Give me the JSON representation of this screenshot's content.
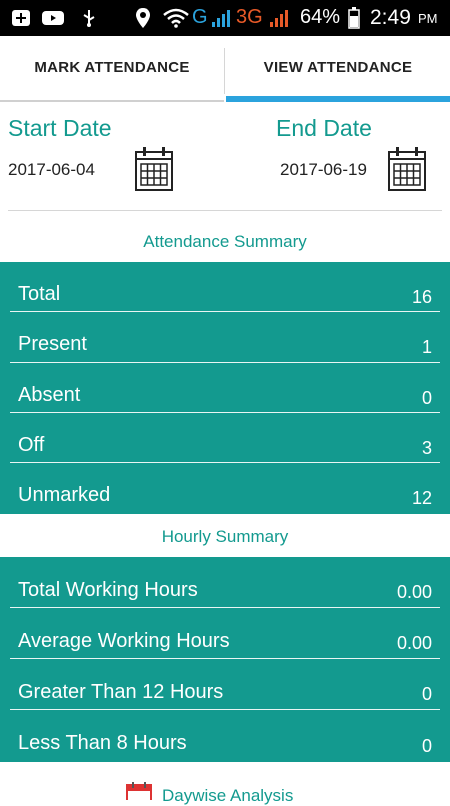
{
  "status_bar": {
    "network_type": "G",
    "network_type_2": "3G",
    "battery": "64%",
    "time": "2:49",
    "ampm": "PM"
  },
  "tabs": {
    "mark": "MARK ATTENDANCE",
    "view": "VIEW ATTENDANCE",
    "active": "view"
  },
  "start_date": {
    "label": "Start Date",
    "value": "2017-06-04"
  },
  "end_date": {
    "label": "End Date",
    "value": "2017-06-19"
  },
  "attendance_summary": {
    "title": "Attendance Summary",
    "rows": [
      {
        "label": "Total",
        "value": "16"
      },
      {
        "label": "Present",
        "value": "1"
      },
      {
        "label": "Absent",
        "value": "0"
      },
      {
        "label": "Off",
        "value": "3"
      },
      {
        "label": "Unmarked",
        "value": "12"
      }
    ]
  },
  "hourly_summary": {
    "title": "Hourly Summary",
    "rows": [
      {
        "label": "Total Working Hours",
        "value": "0.00"
      },
      {
        "label": "Average Working Hours",
        "value": "0.00"
      },
      {
        "label": "Greater Than 12 Hours",
        "value": "0"
      },
      {
        "label": "Less Than 8 Hours",
        "value": "0"
      }
    ]
  },
  "footer": {
    "link": "Daywise Analysis"
  },
  "colors": {
    "teal": "#139a8f",
    "tab_indicator": "#2ba3dd"
  }
}
